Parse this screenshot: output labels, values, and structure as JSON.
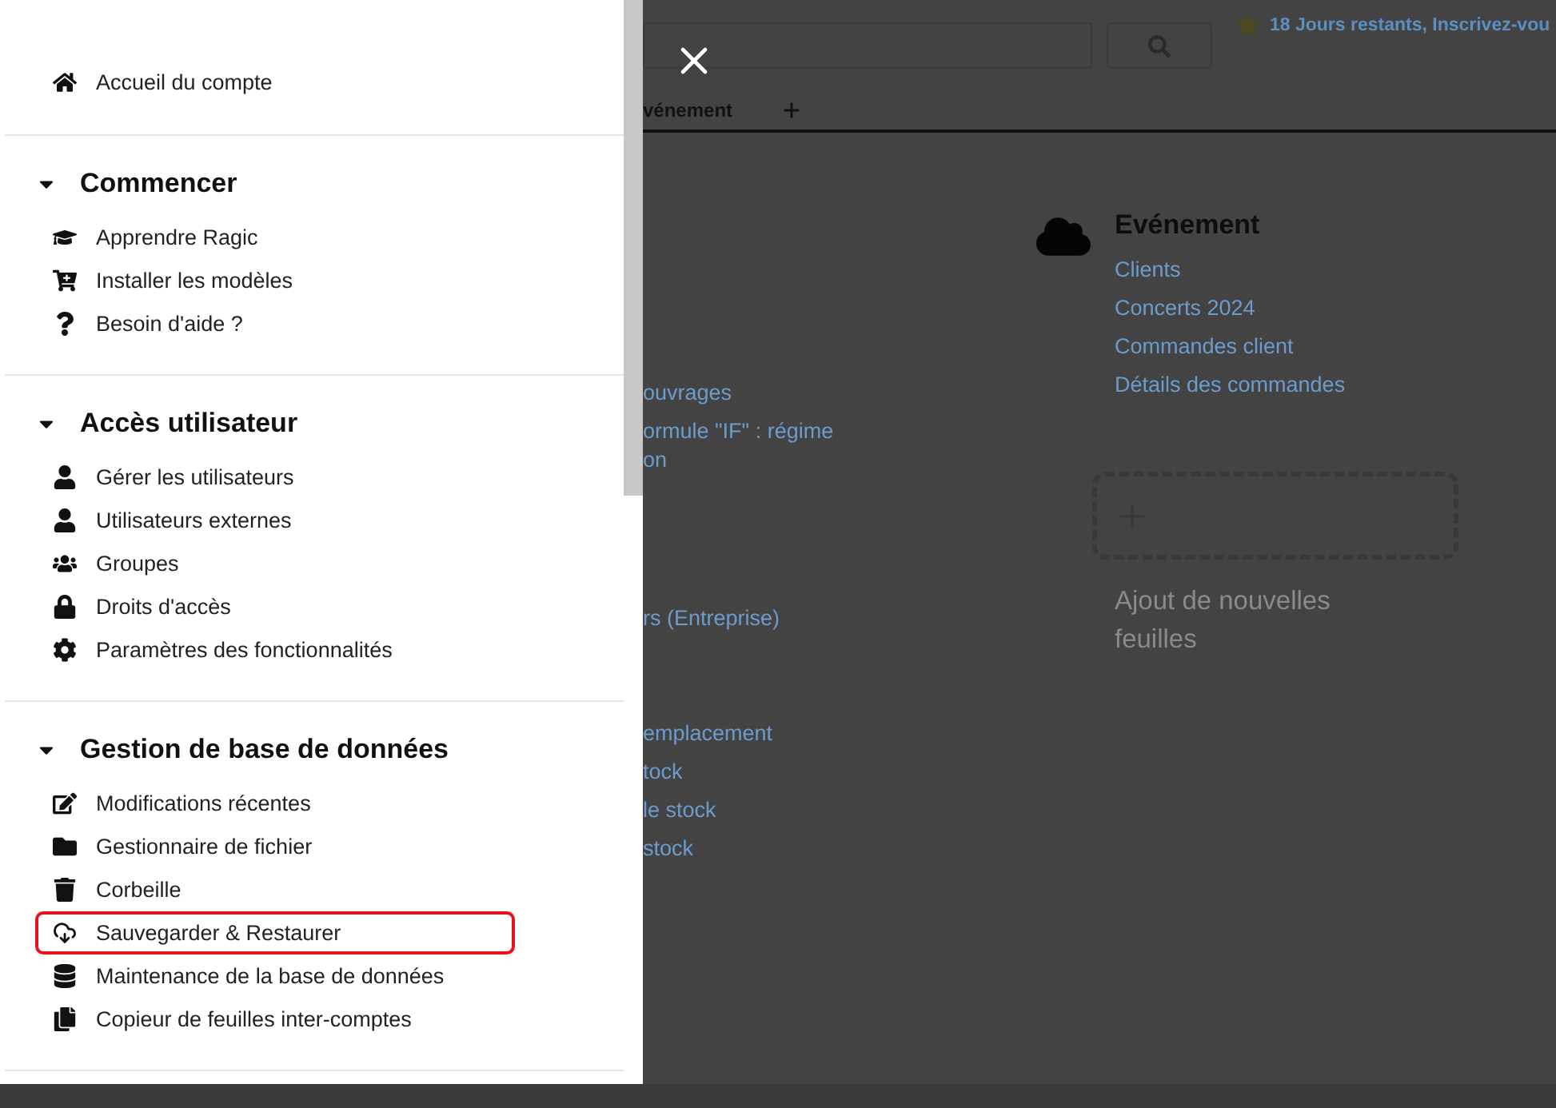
{
  "drawer": {
    "top_item": {
      "label": "Accueil du compte"
    },
    "sections": [
      {
        "title": "Commencer",
        "expanded": true,
        "items": [
          {
            "label": "Apprendre Ragic",
            "highlighted": false
          },
          {
            "label": "Installer les modèles",
            "highlighted": false
          },
          {
            "label": "Besoin d'aide ?",
            "highlighted": false
          }
        ]
      },
      {
        "title": "Accès utilisateur",
        "expanded": true,
        "items": [
          {
            "label": "Gérer les utilisateurs",
            "highlighted": false
          },
          {
            "label": "Utilisateurs externes",
            "highlighted": false
          },
          {
            "label": "Groupes",
            "highlighted": false
          },
          {
            "label": "Droits d'accès",
            "highlighted": false
          },
          {
            "label": "Paramètres des fonctionnalités",
            "highlighted": false
          }
        ]
      },
      {
        "title": "Gestion de base de données",
        "expanded": true,
        "items": [
          {
            "label": "Modifications récentes",
            "highlighted": false
          },
          {
            "label": "Gestionnaire de fichier",
            "highlighted": false
          },
          {
            "label": "Corbeille",
            "highlighted": false
          },
          {
            "label": "Sauvegarder & Restaurer",
            "highlighted": true
          },
          {
            "label": "Maintenance de la base de données",
            "highlighted": false
          },
          {
            "label": "Copieur de feuilles inter-comptes",
            "highlighted": false
          }
        ]
      }
    ]
  },
  "background": {
    "trial_notice": "18 Jours restants, Inscrivez-vou",
    "tabs": [
      {
        "label": "vénement"
      }
    ],
    "left_links": [
      "ouvrages",
      "ormule \"IF\" : régime\non",
      "rs (Entreprise)",
      "emplacement",
      "tock",
      "le stock",
      "stock"
    ],
    "tab_group": {
      "title": "Evénement",
      "links": [
        "Clients",
        "Concerts 2024",
        "Commandes client",
        "Détails des commandes"
      ]
    },
    "add_sheet": {
      "label": "Ajout de nouvelles feuilles"
    }
  }
}
